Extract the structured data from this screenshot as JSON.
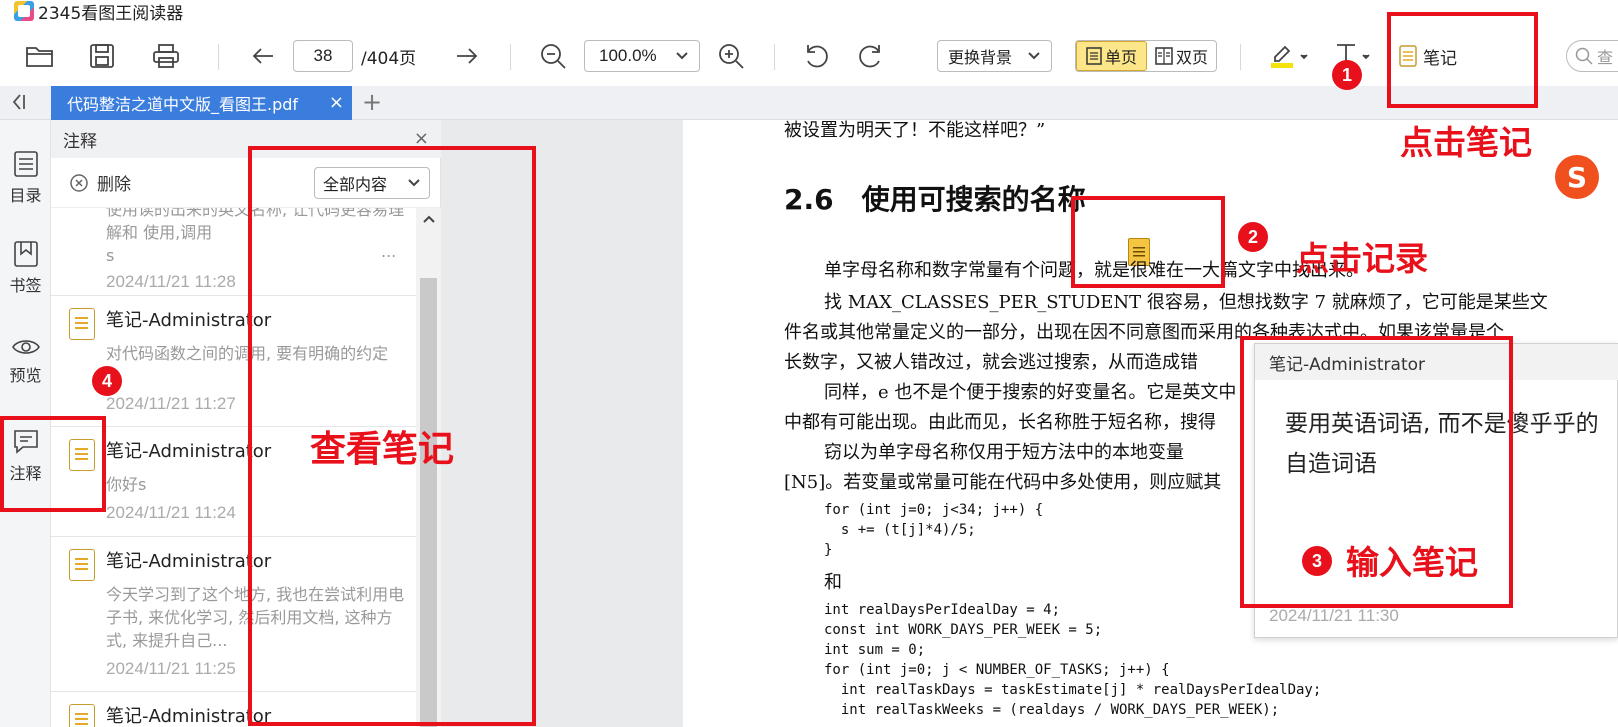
{
  "app": {
    "title": "2345看图王阅读器"
  },
  "toolbar": {
    "page_current": "38",
    "page_total": "/404页",
    "zoom": "100.0%",
    "background_label": "更换背景",
    "single_page_label": "单页",
    "double_page_label": "双页",
    "note_label": "笔记",
    "search_placeholder": "查"
  },
  "tabs": [
    {
      "label": "代码整洁之道中文版_看图王.pdf"
    }
  ],
  "rail": [
    {
      "label": "目录",
      "icon": "list-icon"
    },
    {
      "label": "书签",
      "icon": "bookmark-icon"
    },
    {
      "label": "预览",
      "icon": "eye-icon"
    },
    {
      "label": "注释",
      "icon": "comment-icon"
    }
  ],
  "panel": {
    "title": "注释",
    "delete_label": "删除",
    "filter_label": "全部内容",
    "notes": [
      {
        "title": "",
        "body": "使用读的出来的英文名称, 让代码更容易理解和 使用,调用",
        "body_extra": "s",
        "ellipsis": "...",
        "time": "2024/11/21 11:28"
      },
      {
        "title": "笔记-Administrator",
        "body": "对代码函数之间的调用, 要有明确的约定",
        "time": "2024/11/21 11:27"
      },
      {
        "title": "笔记-Administrator",
        "body": "你好s",
        "time": "2024/11/21 11:24"
      },
      {
        "title": "笔记-Administrator",
        "body": "今天学习到了这个地方, 我也在尝试利用电子书, 来优化学习, 然后利用文档, 这种方式, 来提升自己...",
        "time": "2024/11/21 11:25"
      },
      {
        "title": "笔记-Administrator",
        "body": "",
        "time": ""
      }
    ]
  },
  "document": {
    "top_line": "被设置为明天了！不能这样吧？”",
    "heading": "2.6　使用可搜索的名称",
    "lines": [
      "单字母名称和数字常量有个问题，就是很难在一大篇文字中找出来。",
      "找 MAX_CLASSES_PER_STUDENT 很容易，但想找数字 7 就麻烦了，它可能是某些文",
      "件名或其他常量定义的一部分，出现在因不同意图而采用的各种表达式中。如果该常量是个",
      "长数字，又被人错改过，就会逃过搜索，从而造成错",
      "同样，e 也不是个便于搜索的好变量名。它是英文中",
      "中都有可能出现。由此而见，长名称胜于短名称，搜得",
      "窃以为单字母名称仅用于短方法中的本地变量",
      "[N5]。若变量或常量可能在代码中多处使用，则应赋其"
    ],
    "code1": [
      "for (int j=0; j<34; j++) {",
      "  s += (t[j]*4)/5;",
      "}"
    ],
    "and_word": "和",
    "code2": [
      "int realDaysPerIdealDay = 4;",
      "const int WORK_DAYS_PER_WEEK = 5;",
      "int sum = 0;",
      "for (int j=0; j < NUMBER_OF_TASKS; j++) {",
      "  int realTaskDays = taskEstimate[j] * realDaysPerIdealDay;",
      "  int realTaskWeeks = (realdays / WORK_DAYS_PER_WEEK);"
    ]
  },
  "popup": {
    "title": "笔记-Administrator",
    "body": "要用英语词语, 而不是傻乎乎的自造词语",
    "time": "2024/11/21 11:30"
  },
  "annotations": {
    "step1": "1",
    "step2": "2",
    "step3": "3",
    "step4": "4",
    "click_note": "点击笔记",
    "click_record": "点击记录",
    "view_notes": "查看笔记",
    "input_note": "输入笔记"
  },
  "ime": {
    "glyph": "S"
  },
  "colors": {
    "accent_red": "#e8101a",
    "tab_blue": "#3b7ddd",
    "active_yellow": "#fde68a"
  }
}
